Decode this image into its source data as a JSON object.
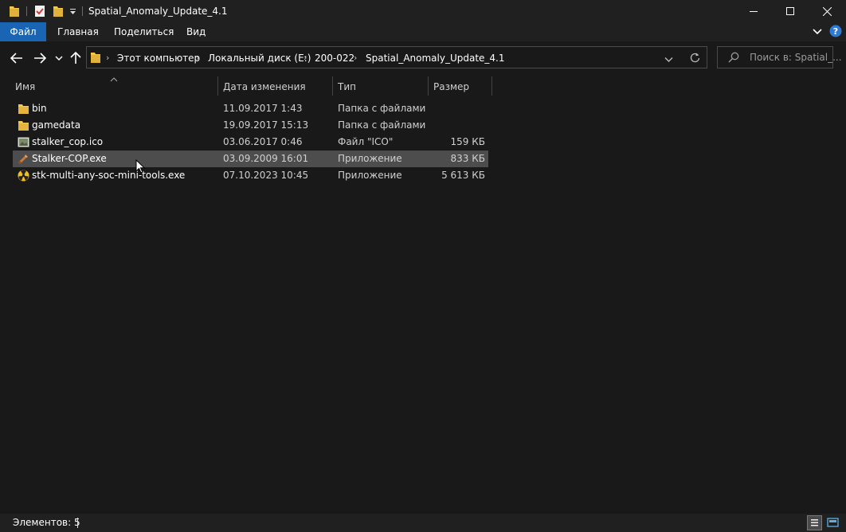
{
  "window": {
    "title": "Spatial_Anomaly_Update_4.1"
  },
  "ribbon": {
    "tabs": [
      "Файл",
      "Главная",
      "Поделиться",
      "Вид"
    ]
  },
  "address": {
    "crumbs": [
      "Этот компьютер",
      "Локальный диск (E:)",
      "200-022",
      "Spatial_Anomaly_Update_4.1"
    ]
  },
  "search": {
    "placeholder": "Поиск в: Spatial_..."
  },
  "columns": {
    "name": "Имя",
    "date": "Дата изменения",
    "type": "Тип",
    "size": "Размер"
  },
  "files": [
    {
      "name": "bin",
      "date": "11.09.2017 1:43",
      "type": "Папка с файлами",
      "size": "",
      "icon": "folder-icon"
    },
    {
      "name": "gamedata",
      "date": "19.09.2017 15:13",
      "type": "Папка с файлами",
      "size": "",
      "icon": "folder-icon"
    },
    {
      "name": "stalker_cop.ico",
      "date": "03.06.2017 0:46",
      "type": "Файл \"ICO\"",
      "size": "159 КБ",
      "icon": "image-file-icon"
    },
    {
      "name": "Stalker-COP.exe",
      "date": "03.09.2009 16:01",
      "type": "Приложение",
      "size": "833 КБ",
      "icon": "app-exe-icon",
      "selected": true
    },
    {
      "name": "stk-multi-any-soc-mini-tools.exe",
      "date": "07.10.2023 10:45",
      "type": "Приложение",
      "size": "5 613 КБ",
      "icon": "radiation-exe-icon"
    }
  ],
  "status": {
    "count": "Элементов: 5"
  },
  "colors": {
    "accent": "#1a64b4",
    "background": "#191919",
    "selection": "#4d4d4d",
    "folder": "#f4c94a"
  }
}
